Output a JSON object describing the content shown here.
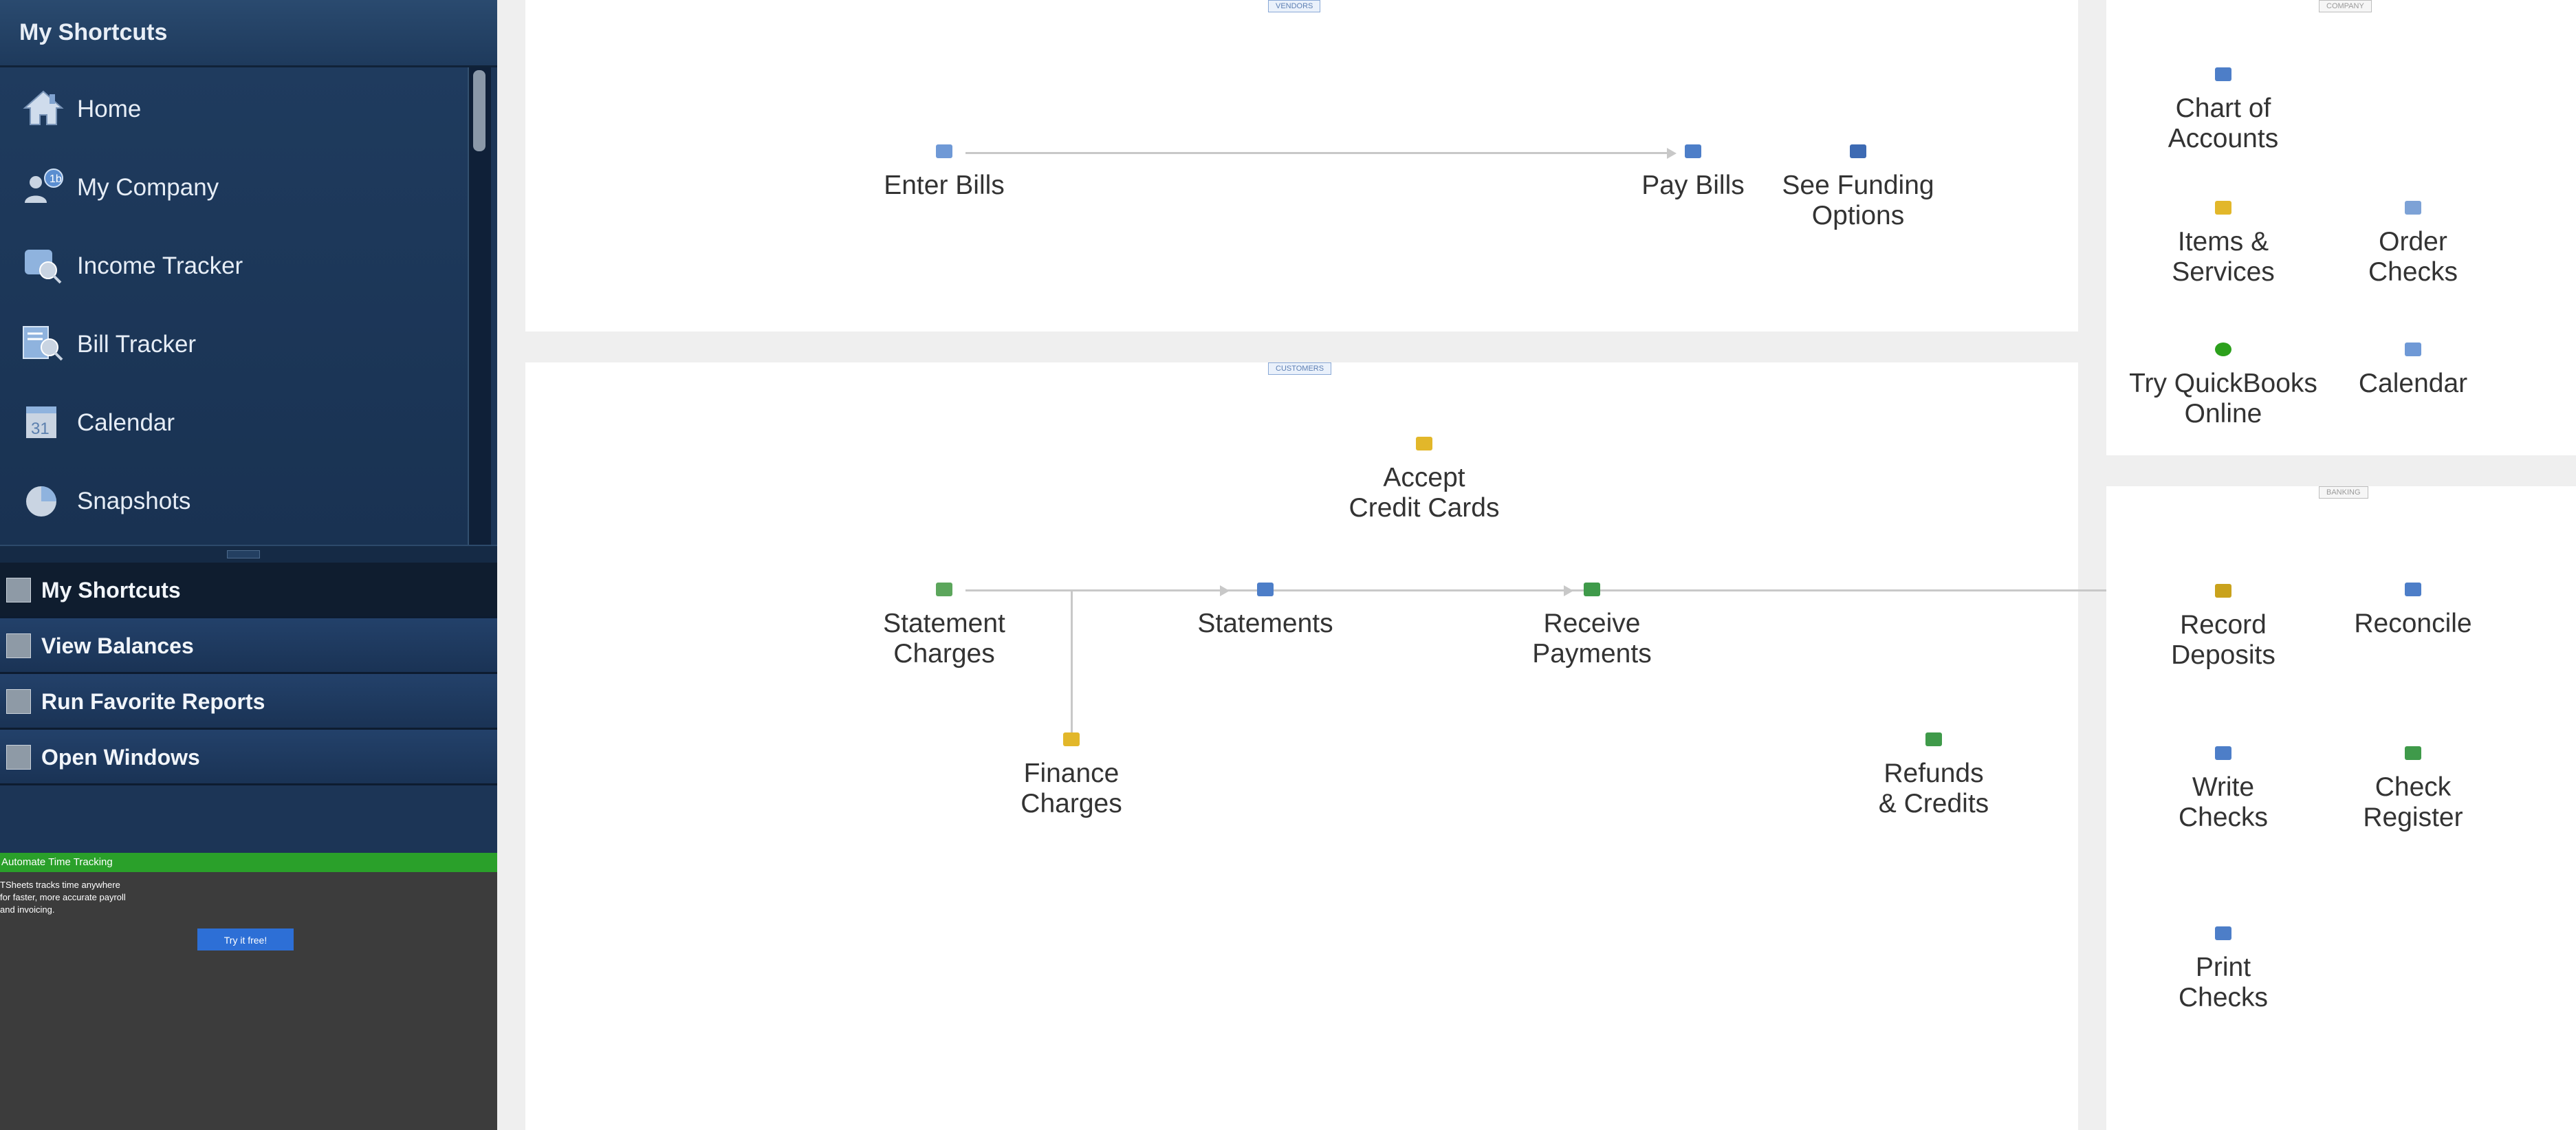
{
  "sidebar": {
    "title": "My Shortcuts",
    "items": [
      {
        "label": "Home",
        "icon": "home-icon"
      },
      {
        "label": "My Company",
        "icon": "my-company-icon"
      },
      {
        "label": "Income Tracker",
        "icon": "income-tracker-icon"
      },
      {
        "label": "Bill Tracker",
        "icon": "bill-tracker-icon"
      },
      {
        "label": "Calendar",
        "icon": "calendar-icon"
      },
      {
        "label": "Snapshots",
        "icon": "snapshots-icon"
      }
    ],
    "sections": [
      {
        "label": "My Shortcuts"
      },
      {
        "label": "View Balances"
      },
      {
        "label": "Run Favorite Reports"
      },
      {
        "label": "Open Windows"
      }
    ],
    "promo": {
      "title": "Automate Time Tracking",
      "line1": "TSheets tracks time anywhere",
      "line2": "for faster, more accurate payroll",
      "line3": "and invoicing.",
      "button": "Try it free!"
    }
  },
  "vendors": {
    "tag": "VENDORS",
    "enter_bills": "Enter Bills",
    "pay_bills": "Pay Bills",
    "funding": "See Funding\nOptions"
  },
  "customers": {
    "tag": "CUSTOMERS",
    "accept_cc": "Accept\nCredit Cards",
    "statement_charges": "Statement\nCharges",
    "statements": "Statements",
    "receive_payments": "Receive\nPayments",
    "finance_charges": "Finance\nCharges",
    "refunds": "Refunds\n& Credits"
  },
  "company": {
    "tag": "COMPANY",
    "chart_of_accounts": "Chart of\nAccounts",
    "items_services": "Items &\nServices",
    "order_checks": "Order\nChecks",
    "try_qbo": "Try QuickBooks\nOnline",
    "calendar": "Calendar"
  },
  "banking": {
    "tag": "BANKING",
    "record_deposits": "Record\nDeposits",
    "reconcile": "Reconcile",
    "write_checks": "Write\nChecks",
    "check_register": "Check\nRegister",
    "print_checks": "Print\nChecks"
  },
  "colors": {
    "sidebar_bg": "#1c3556",
    "panel_bg": "#ffffff",
    "page_bg": "#efefef",
    "promo_green": "#2aa02a",
    "promo_button": "#2d6fd6",
    "flow_line": "#c8c8c8"
  }
}
